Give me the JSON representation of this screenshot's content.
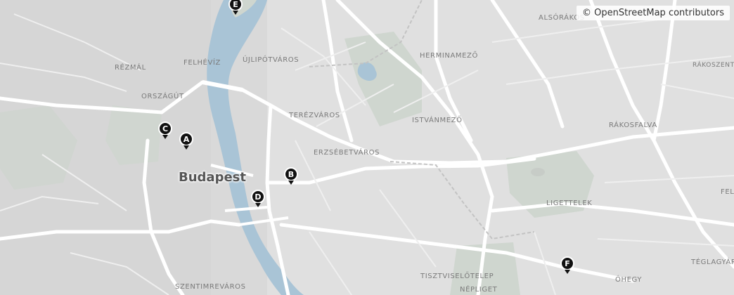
{
  "attribution": "© OpenStreetMap contributors",
  "city_label": "Budapest",
  "districts": {
    "alsorakos": "ALSÓRÁKOS",
    "rezmal": "RÉZMÁL",
    "felheviz": "FELHÉVÍZ",
    "ujlipotvaros": "ÚJLIPÓTVÁROS",
    "herminamezo": "HERMINAMEZŐ",
    "orszagut": "ORSZÁGÚT",
    "terezvaros": "TERÉZVÁROS",
    "istvanmezo": "ISTVÁNMEZŐ",
    "rakosfalva": "RÁKOSFALVA",
    "erzsebetvaros": "ERZSÉBETVÁROS",
    "ligettelek": "LIGETTELEK",
    "tisztviselotelep": "TISZTVISELŐTELEP",
    "nepliget": "NÉPLIGET",
    "ohegy": "ÓHEGY",
    "szentimrevaros": "SZENTIMREVÁROS",
    "teglagyar": "TÉGLAGYÁR",
    "rakoszent": "RÁKOSZENT",
    "fels": "FELS"
  },
  "markers": {
    "a": "A",
    "b": "B",
    "c": "C",
    "d": "D",
    "e": "E",
    "f": "F"
  },
  "colors": {
    "background": "#d9d9d9",
    "river": "#a9c4d6",
    "park": "#cfd6cf",
    "road": "#ffffff",
    "marker": "#111111"
  }
}
